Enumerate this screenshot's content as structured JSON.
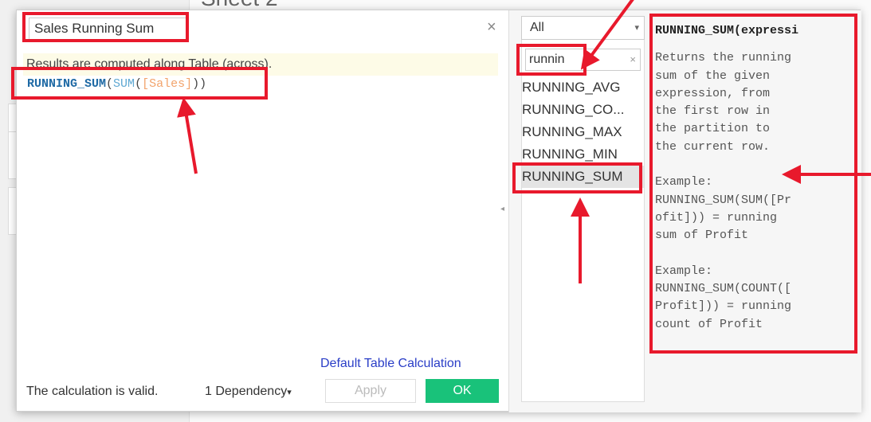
{
  "background": {
    "sheet_title": "Sheet 2"
  },
  "dialog": {
    "calc_name": "Sales Running Sum",
    "close_glyph": "×",
    "info_message": "Results are computed along Table (across).",
    "formula": {
      "func": "RUNNING_SUM",
      "open1": "(",
      "agg": "SUM",
      "open2": "(",
      "field": "[Sales]",
      "close": "))"
    },
    "default_table_calc_link": "Default Table Calculation",
    "status": "The calculation is valid.",
    "dependency_label": "1 Dependency",
    "dependency_caret": "▾",
    "apply_label": "Apply",
    "ok_label": "OK"
  },
  "function_panel": {
    "category_selected": "All",
    "category_caret": "▾",
    "search_value": "runnin",
    "clear_glyph": "×",
    "functions": [
      "RUNNING_AVG",
      "RUNNING_CO...",
      "RUNNING_MAX",
      "RUNNING_MIN",
      "RUNNING_SUM"
    ],
    "selected_index": 4
  },
  "description": {
    "title": "RUNNING_SUM(expressi",
    "body": "Returns the running\nsum of the given\nexpression, from\nthe first row in\nthe partition to\nthe current row.\n\nExample:\nRUNNING_SUM(SUM([Pr\nofit])) = running\nsum of Profit\n\nExample:\nRUNNING_SUM(COUNT([\nProfit])) = running\ncount of Profit"
  },
  "annotation_color": "#e8192c"
}
